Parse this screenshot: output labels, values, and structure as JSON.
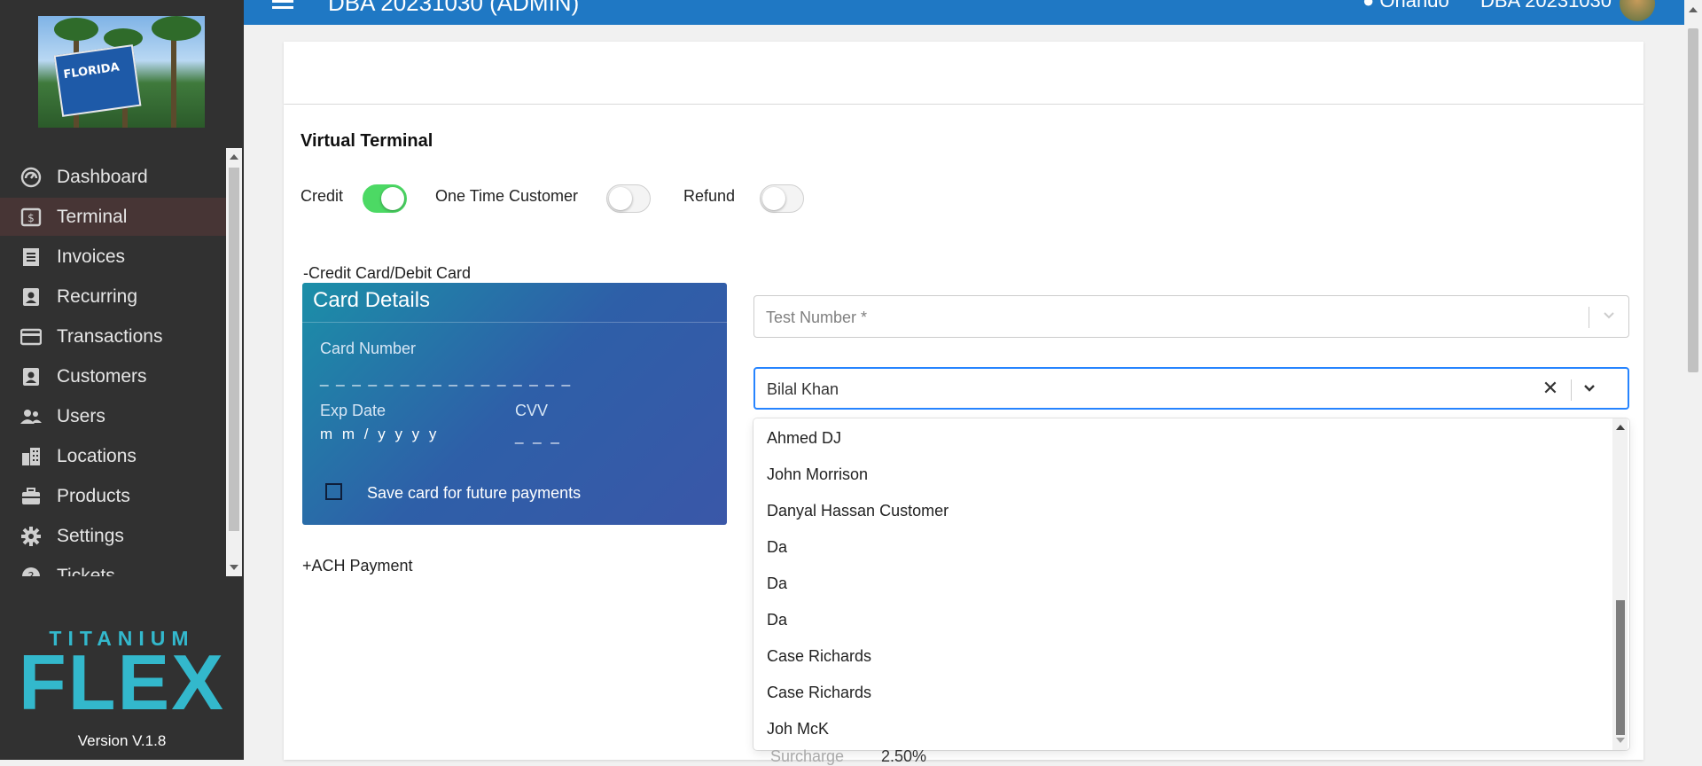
{
  "topbar": {
    "title": "DBA 20231030 (ADMIN)",
    "location": "Orlando",
    "account": "DBA 20231030"
  },
  "sidebar": {
    "logo_sign_text": "FLORIDA",
    "items": [
      {
        "label": "Dashboard",
        "icon": "dashboard-icon"
      },
      {
        "label": "Terminal",
        "icon": "terminal-icon",
        "active": true
      },
      {
        "label": "Invoices",
        "icon": "invoice-icon"
      },
      {
        "label": "Recurring",
        "icon": "recurring-icon"
      },
      {
        "label": "Transactions",
        "icon": "credit-card-icon"
      },
      {
        "label": "Customers",
        "icon": "customer-icon"
      },
      {
        "label": "Users",
        "icon": "users-icon"
      },
      {
        "label": "Locations",
        "icon": "building-icon"
      },
      {
        "label": "Products",
        "icon": "briefcase-icon"
      },
      {
        "label": "Settings",
        "icon": "gear-icon"
      },
      {
        "label": "Tickets",
        "icon": "ticket-icon"
      }
    ],
    "brand_top": "TITANIUM",
    "brand_main": "FLEX",
    "version": "Version V.1.8"
  },
  "main": {
    "title": "Virtual Terminal",
    "toggles": [
      {
        "label": "Credit",
        "on": true
      },
      {
        "label": "One Time Customer",
        "on": false
      },
      {
        "label": "Refund",
        "on": false
      }
    ],
    "card_section_label": "-Credit Card/Debit Card",
    "card": {
      "title": "Card Details",
      "number_label": "Card Number",
      "number_placeholder": "_ _ _ _ _ _ _ _ _ _ _ _ _ _ _ _",
      "exp_label": "Exp Date",
      "exp_placeholder": "m m / y y y y",
      "cvv_label": "CVV",
      "cvv_placeholder": "_ _ _",
      "save_label": "Save card for future payments"
    },
    "ach_label": "+ACH Payment",
    "test_number_placeholder": "Test Number *",
    "customer_select_value": "Bilal Khan",
    "customer_options": [
      "Ahmed DJ",
      "John Morrison",
      "Danyal Hassan Customer",
      "Da",
      "Da",
      "Da",
      "Case Richards",
      "Case Richards",
      "Joh McK"
    ],
    "surcharge_label": "Surcharge",
    "surcharge_value": "2.50%"
  },
  "colors": {
    "topbar": "#1f78c4",
    "sidebar": "#313131",
    "brand": "#33b8cc",
    "toggle_on": "#4cd964",
    "focus": "#2684ff"
  }
}
